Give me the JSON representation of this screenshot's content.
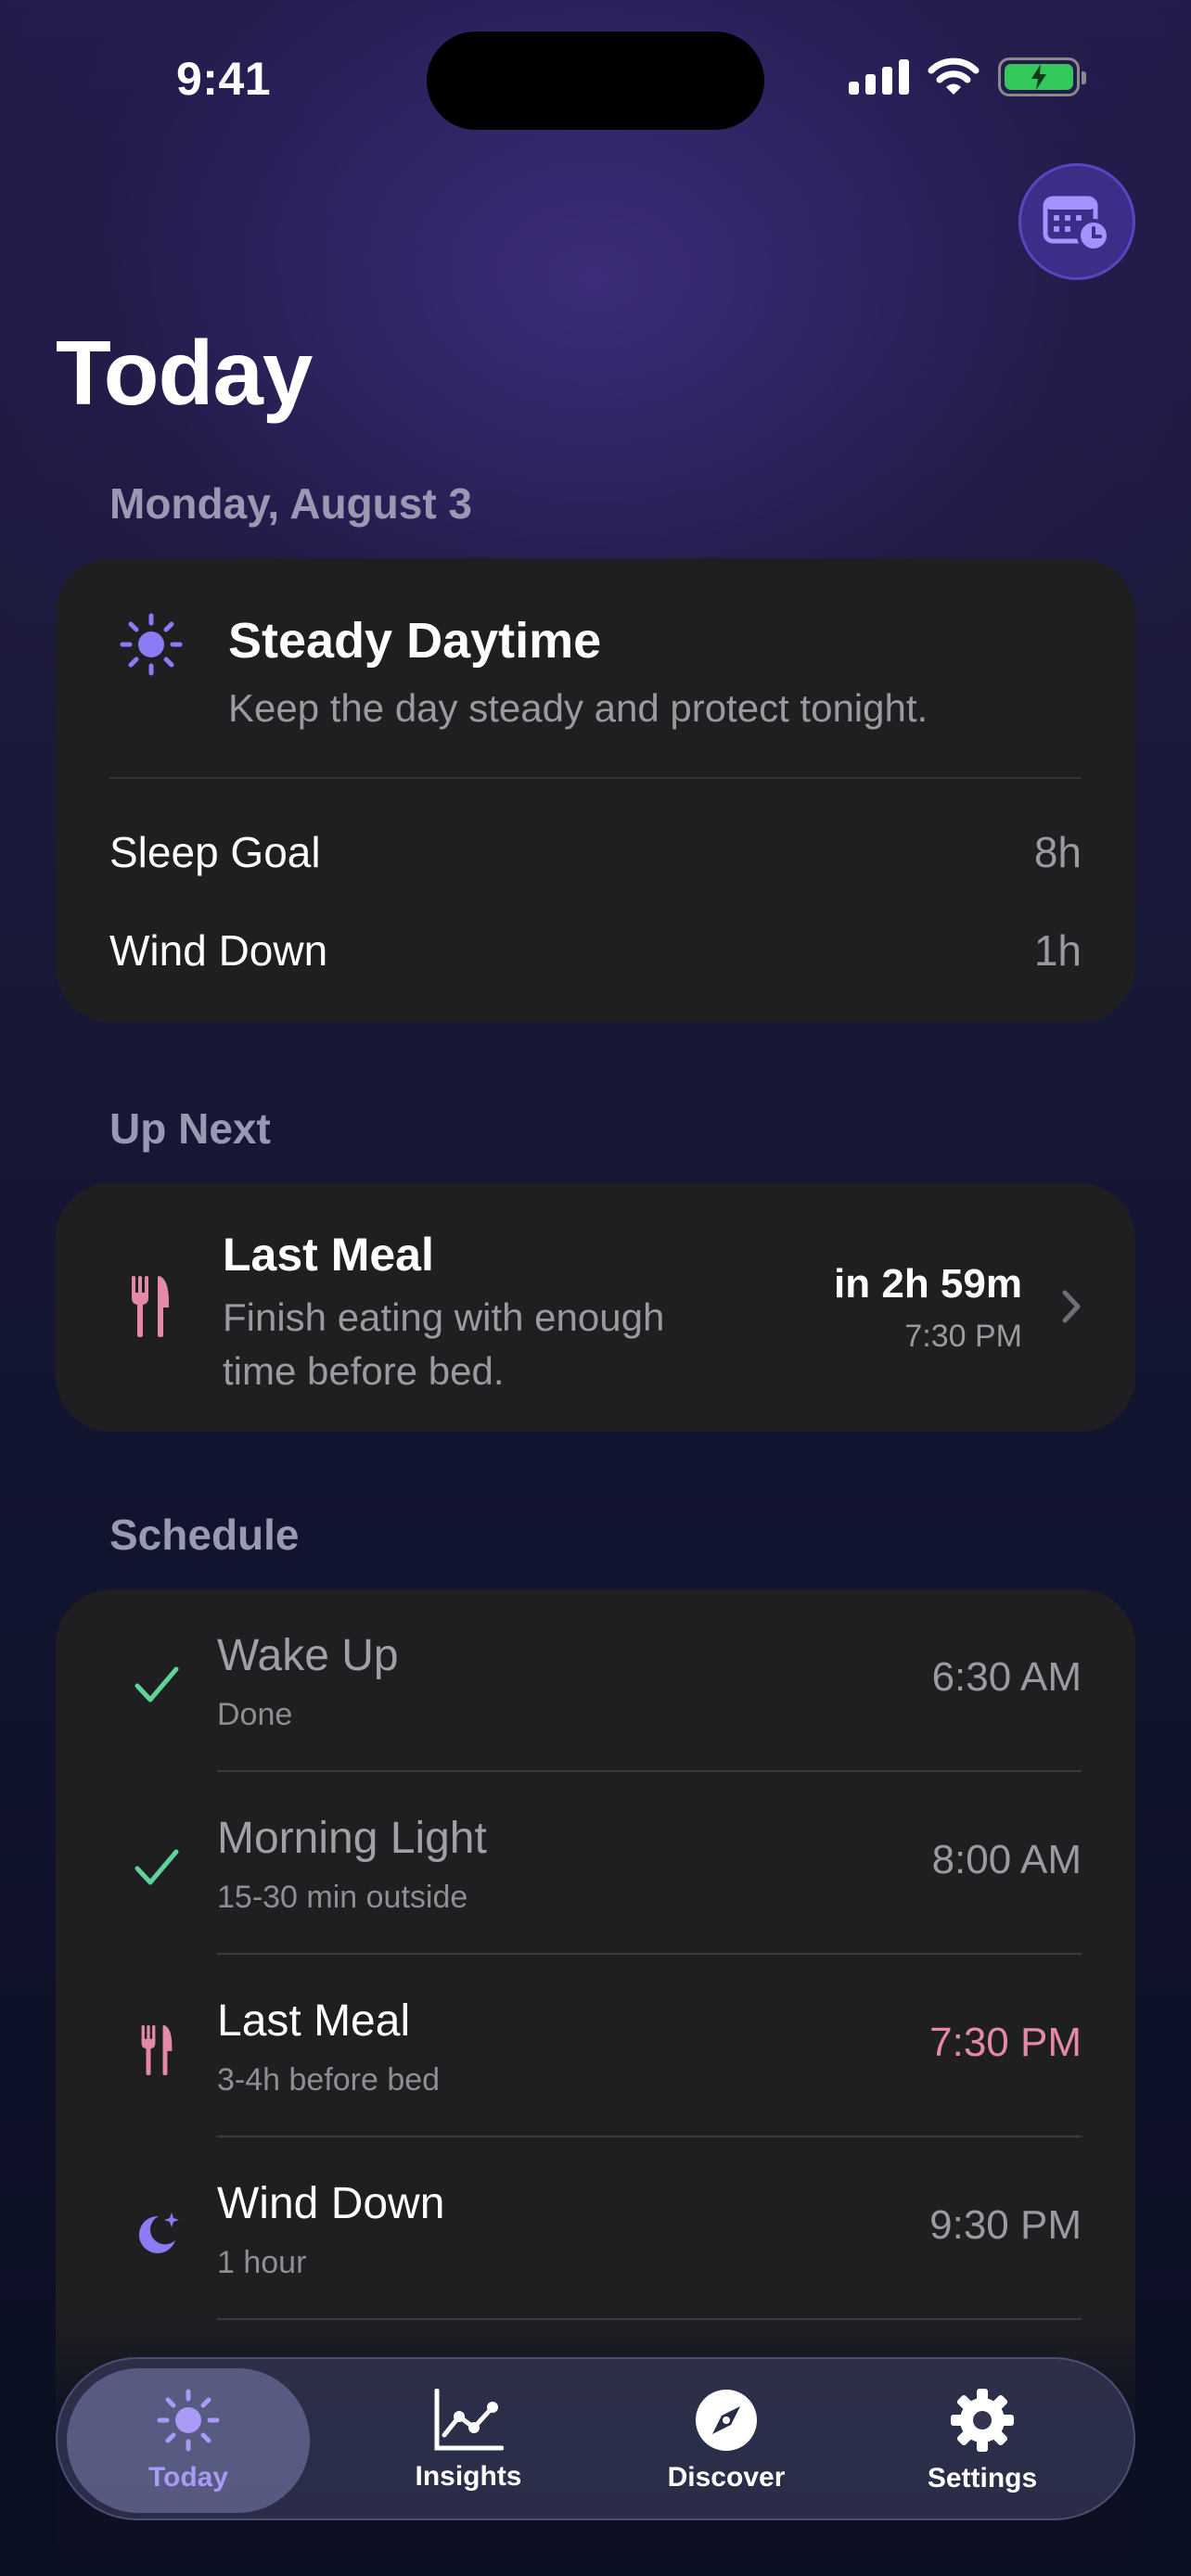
{
  "status_bar": {
    "time": "9:41"
  },
  "header": {
    "title": "Today",
    "date": "Monday, August 3"
  },
  "daytime_card": {
    "title": "Steady Daytime",
    "subtitle": "Keep the day steady and protect tonight.",
    "rows": [
      {
        "label": "Sleep Goal",
        "value": "8h"
      },
      {
        "label": "Wind Down",
        "value": "1h"
      }
    ]
  },
  "up_next": {
    "section_label": "Up Next",
    "title": "Last Meal",
    "subtitle": "Finish eating with enough time before bed.",
    "eta": "in 2h 59m",
    "time": "7:30 PM"
  },
  "schedule": {
    "section_label": "Schedule",
    "items": [
      {
        "title": "Wake Up",
        "subtitle": "Done",
        "time": "6:30 AM",
        "icon": "check-icon"
      },
      {
        "title": "Morning Light",
        "subtitle": "15-30 min outside",
        "time": "8:00 AM",
        "icon": "check-icon"
      },
      {
        "title": "Last Meal",
        "subtitle": "3-4h before bed",
        "time": "7:30 PM",
        "icon": "fork-knife-icon"
      },
      {
        "title": "Wind Down",
        "subtitle": "1 hour",
        "time": "9:30 PM",
        "icon": "moon-icon"
      }
    ]
  },
  "tabs": [
    {
      "label": "Today",
      "icon": "sun-icon",
      "active": true
    },
    {
      "label": "Insights",
      "icon": "chart-icon",
      "active": false
    },
    {
      "label": "Discover",
      "icon": "compass-icon",
      "active": false
    },
    {
      "label": "Settings",
      "icon": "gear-icon",
      "active": false
    }
  ],
  "colors": {
    "accent": "#8b7cf6",
    "check": "#5ed39a",
    "meal": "#e58aa6",
    "card": "#1f1f22"
  }
}
